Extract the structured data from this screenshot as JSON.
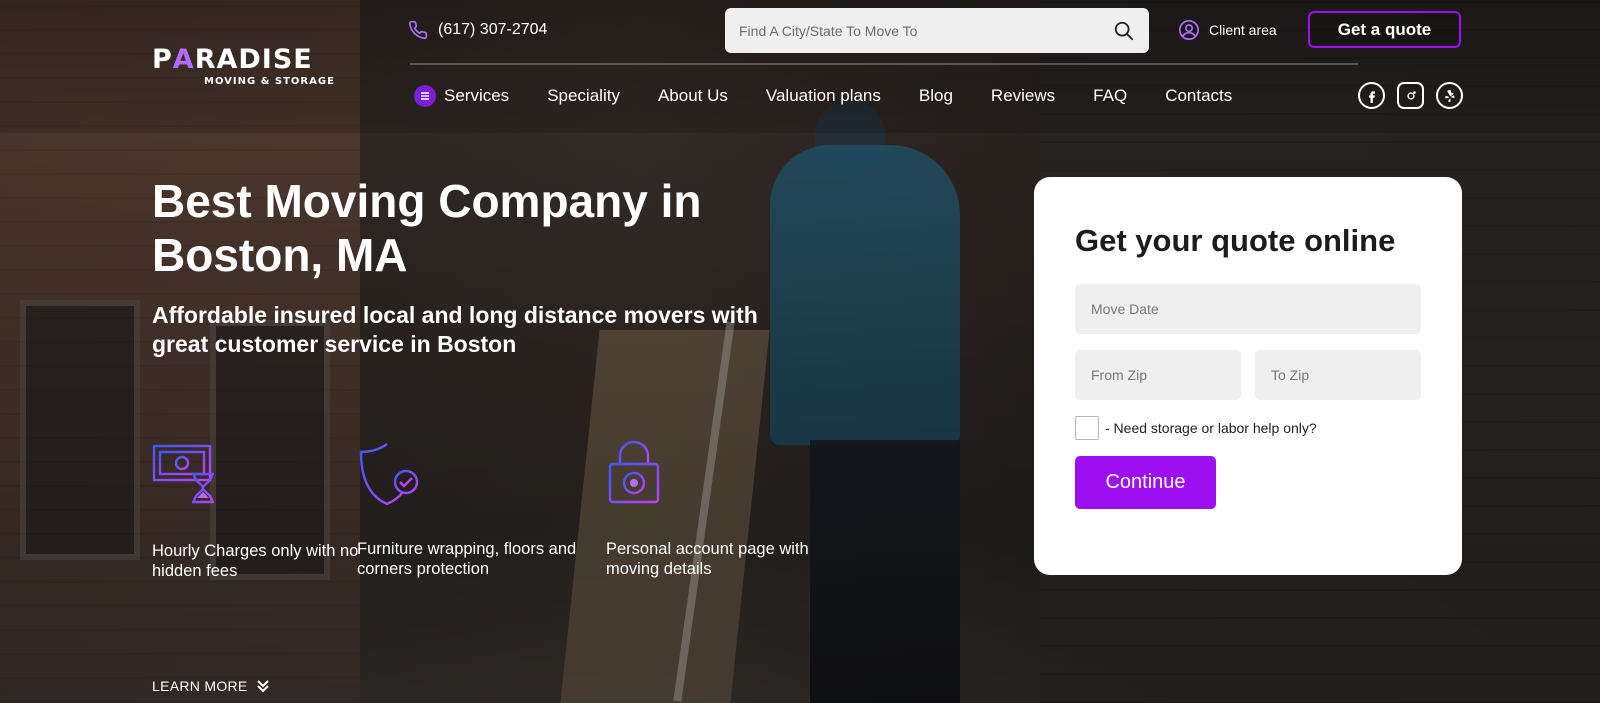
{
  "brand": {
    "logo_prefix": "P",
    "logo_accent": "A",
    "logo_suffix": "RADISE",
    "logo_subtitle": "MOVING & STORAGE",
    "accent_color": "#a20bf0"
  },
  "header": {
    "phone": "(617) 307-2704",
    "search_placeholder": "Find A City/State To Move To",
    "client_area": "Client area",
    "quote_button": "Get a quote"
  },
  "nav": {
    "items": [
      {
        "label": "Services"
      },
      {
        "label": "Speciality"
      },
      {
        "label": "About Us"
      },
      {
        "label": "Valuation plans"
      },
      {
        "label": "Blog"
      },
      {
        "label": "Reviews"
      },
      {
        "label": "FAQ"
      },
      {
        "label": "Contacts"
      }
    ],
    "social": [
      "facebook-icon",
      "instagram-icon",
      "yelp-icon"
    ]
  },
  "hero": {
    "title": "Best Moving Company in Boston, MA",
    "subtitle": "Affordable insured local and long distance movers with great customer service in Boston",
    "features": [
      {
        "icon": "money-hourglass-icon",
        "text": "Hourly Charges only with no hidden fees"
      },
      {
        "icon": "shield-check-icon",
        "text": "Furniture wrapping, floors and corners protection"
      },
      {
        "icon": "lock-account-icon",
        "text": "Personal account page with moving details"
      }
    ],
    "learn_more": "LEARN MORE"
  },
  "quote_form": {
    "title": "Get your quote online",
    "move_date_placeholder": "Move Date",
    "from_zip_placeholder": "From Zip",
    "to_zip_placeholder": "To Zip",
    "checkbox_label": "- Need storage or labor help only?",
    "continue_label": "Continue"
  }
}
